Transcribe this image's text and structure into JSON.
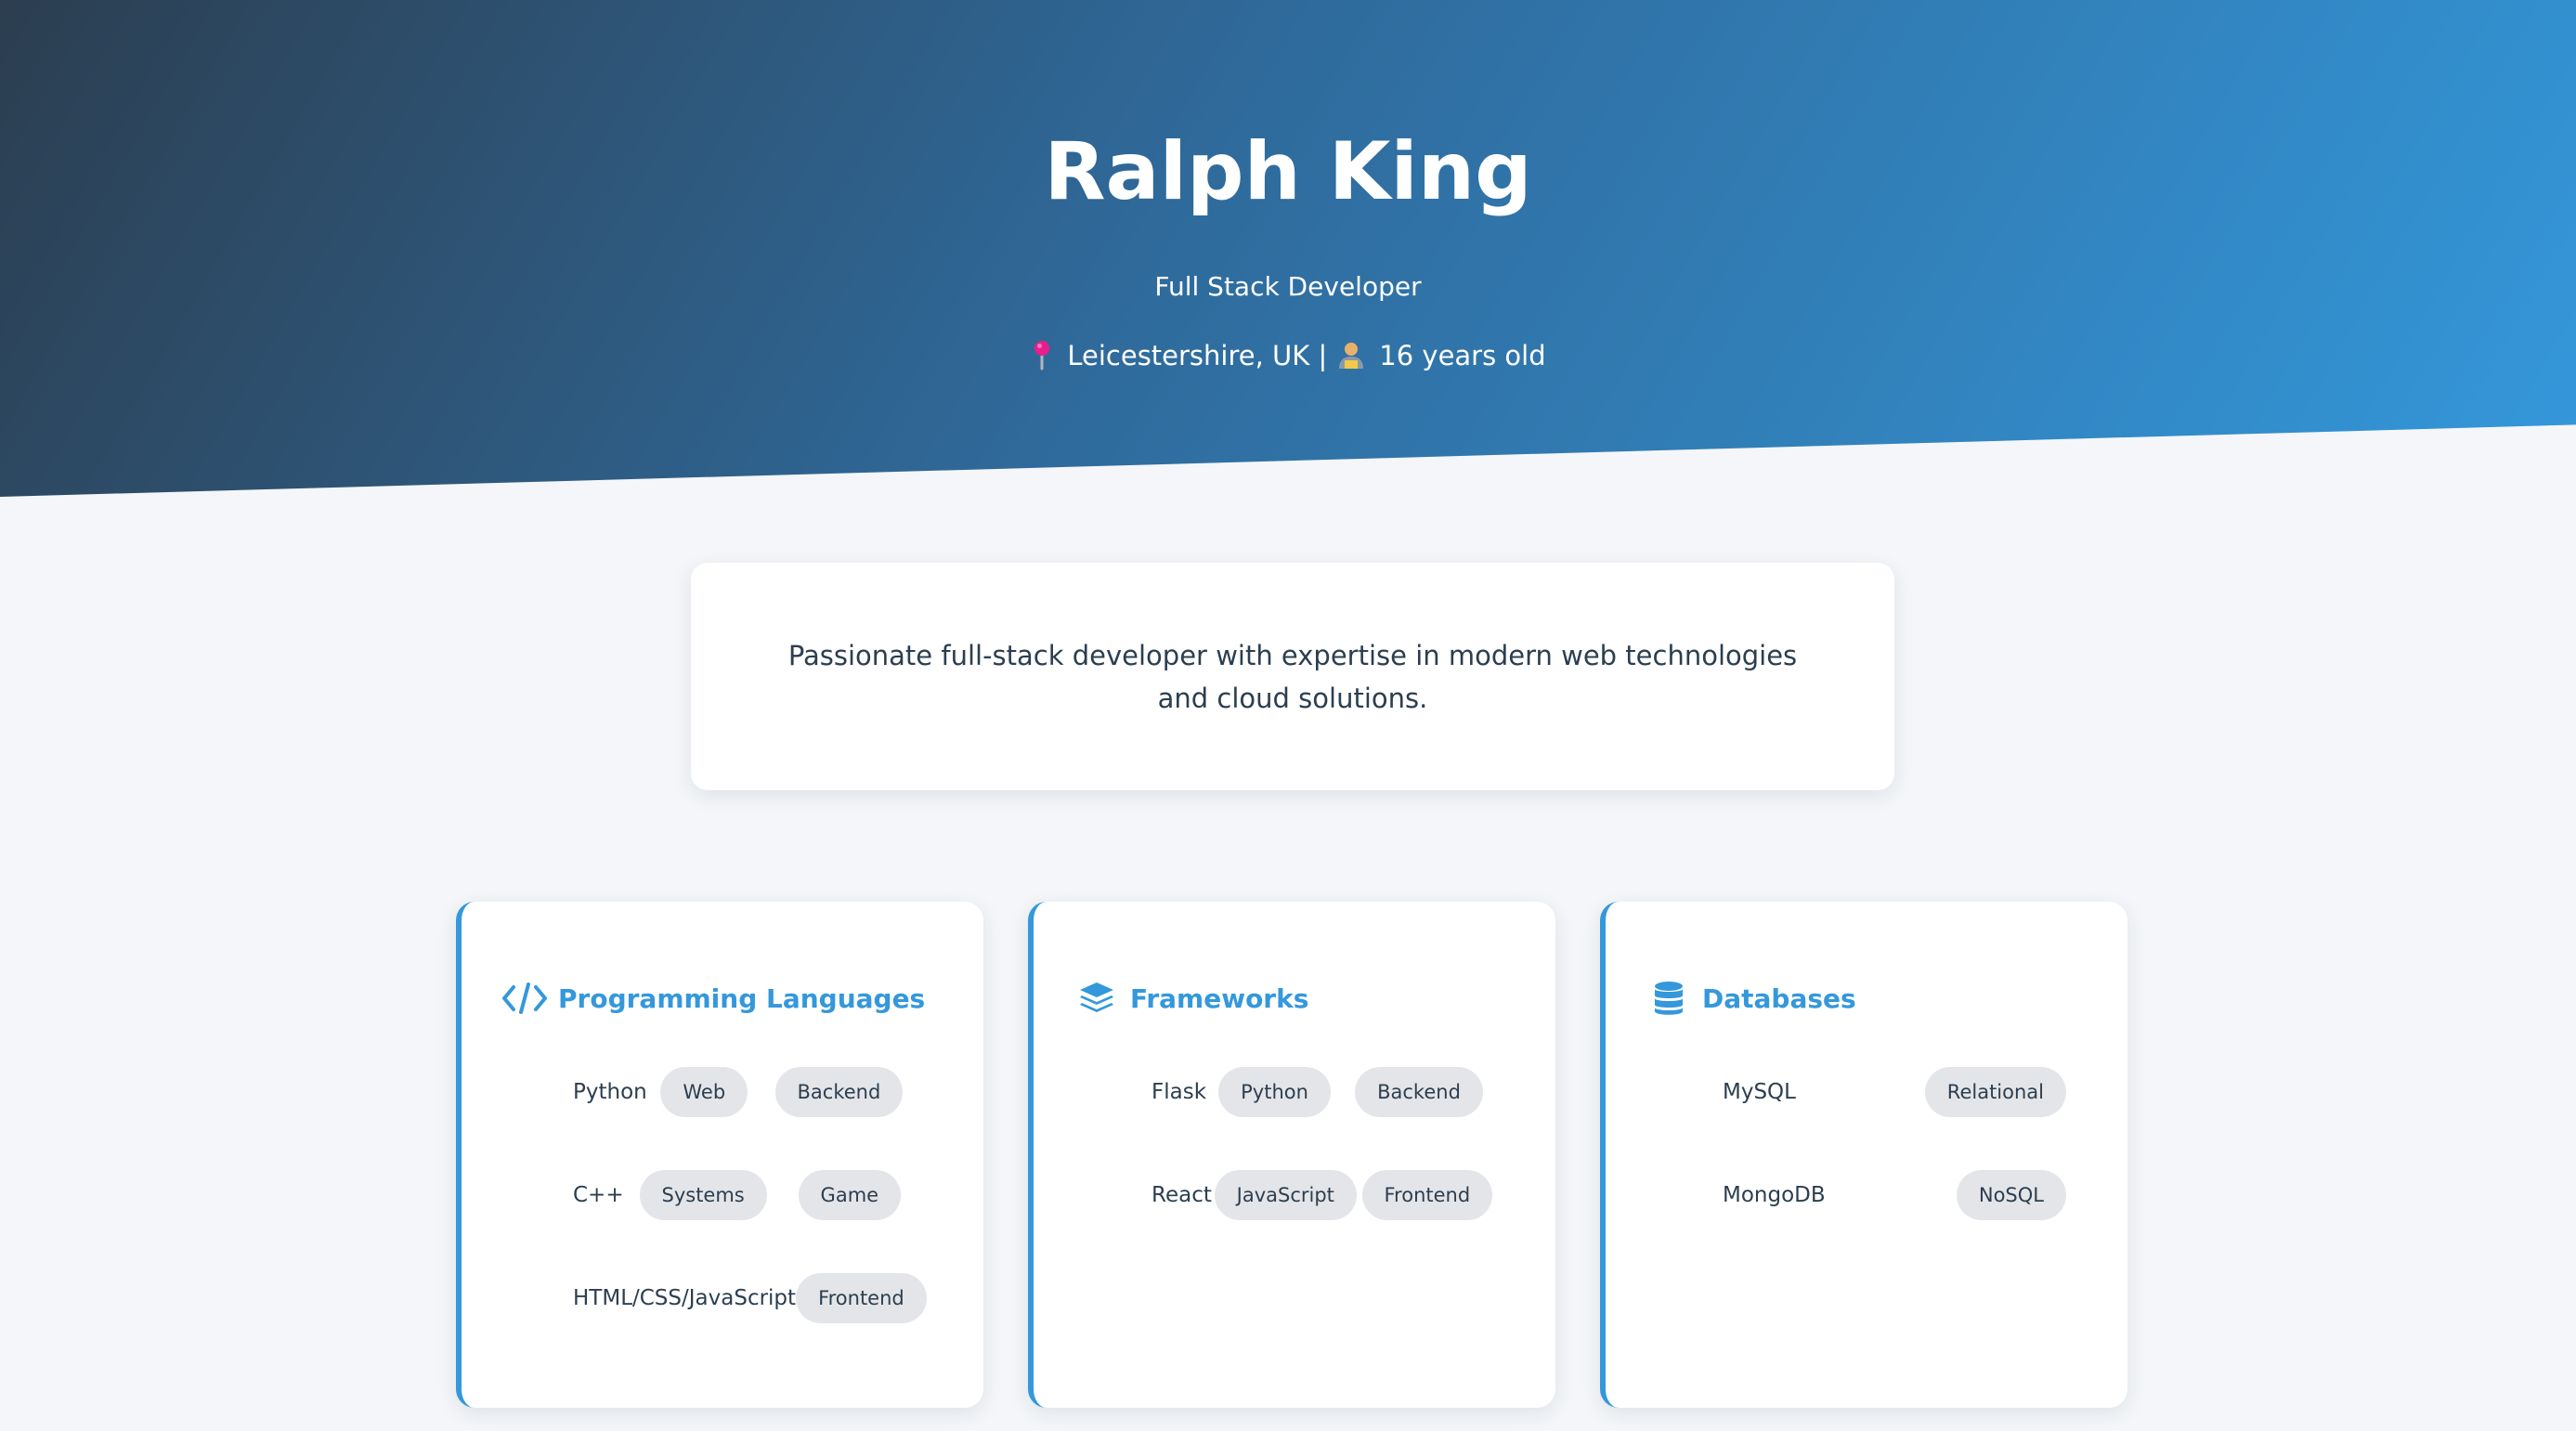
{
  "profile": {
    "name": "Ralph King",
    "role": "Full Stack Developer",
    "location": "Leicestershire, UK |",
    "age": "16 years old"
  },
  "summary": {
    "text": "Passionate full-stack developer with expertise in modern web technologies and cloud solutions."
  },
  "colors": {
    "accent": "#3498db",
    "header_dark": "#2c3e50",
    "tag_bg": "#e4e5e8",
    "page_bg": "#f4f6f9"
  },
  "skills": [
    {
      "title": "Programming Languages",
      "icon": "code-icon",
      "items": [
        {
          "name": "Python",
          "tags": [
            "Web",
            "Backend"
          ]
        },
        {
          "name": "C++",
          "tags": [
            "Systems",
            "Game"
          ]
        },
        {
          "name": "HTML/CSS/JavaScript",
          "tags": [
            "Frontend"
          ]
        }
      ]
    },
    {
      "title": "Frameworks",
      "icon": "layers-icon",
      "items": [
        {
          "name": "Flask",
          "tags": [
            "Python",
            "Backend"
          ]
        },
        {
          "name": "React",
          "tags": [
            "JavaScript",
            "Frontend"
          ]
        }
      ]
    },
    {
      "title": "Databases",
      "icon": "database-icon",
      "items": [
        {
          "name": "MySQL",
          "tags": [
            "Relational"
          ]
        },
        {
          "name": "MongoDB",
          "tags": [
            "NoSQL"
          ]
        }
      ]
    }
  ]
}
